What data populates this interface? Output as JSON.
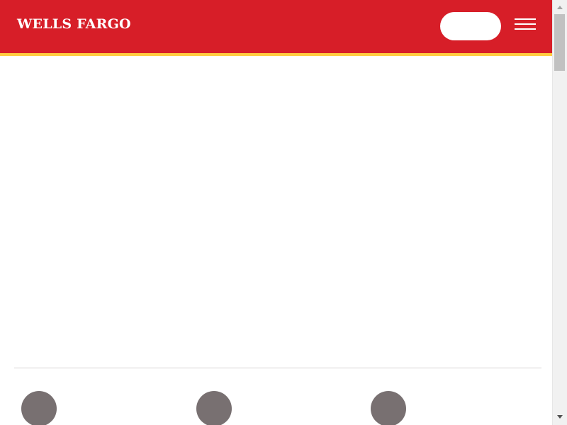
{
  "header": {
    "logo_text": "WELLS FARGO",
    "signon_label": "",
    "menu_icon": "hamburger-menu-icon",
    "brand_color": "#d71e28",
    "stripe_color": "#ffcd41"
  },
  "quick_links": {
    "icon_color": "#787071",
    "items": [
      {
        "label": ""
      },
      {
        "label": ""
      },
      {
        "label": ""
      }
    ]
  },
  "scrollbar": {
    "up_icon": "triangle-up-icon",
    "down_icon": "triangle-down-icon"
  }
}
